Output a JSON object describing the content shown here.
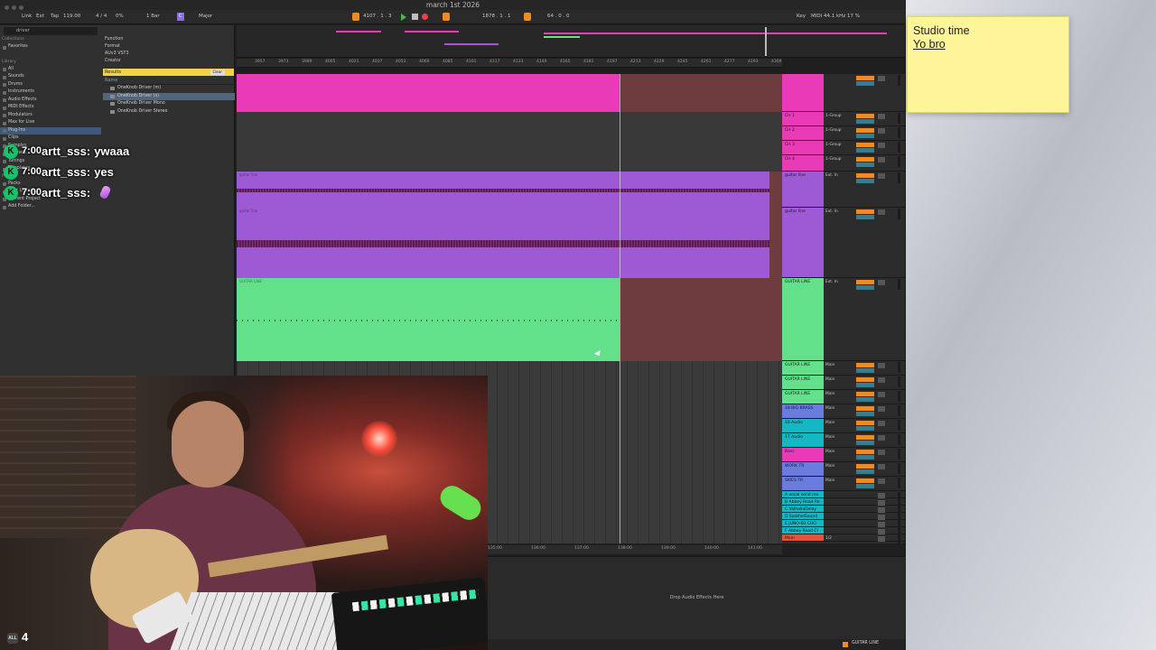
{
  "window": {
    "title": "march 1st 2026"
  },
  "transport": {
    "link": "Link",
    "ext": "Ext",
    "tap": "Tap",
    "tempo": "119.00",
    "signature": "4 / 4",
    "percent": "0%",
    "bar": "1 Bar",
    "key_root": "C",
    "scale": "Major",
    "position": "4107 . 1 . 3",
    "loop_start": "1878 . 1 . 1",
    "loop_len": "64 . 0 . 0",
    "key_label": "Key",
    "midi_label": "MIDI",
    "sample_rate": "44.1 kHz",
    "cpu": "17 %"
  },
  "browser": {
    "search_value": "driver",
    "collections_head": "Collections",
    "favorites": "Favorites",
    "library_head": "Library",
    "library": [
      "All",
      "Sounds",
      "Drums",
      "Instruments",
      "Audio Effects",
      "MIDI Effects",
      "Modulators",
      "Max for Live",
      "Plug-Ins",
      "Clips",
      "Samples",
      "Grooves",
      "Tunings",
      "Templates"
    ],
    "places_head": "Places",
    "places": [
      "Packs",
      "User Library",
      "Current Project",
      "Add Folder..."
    ],
    "filters": [
      "Function",
      "Format",
      "AUv3   VST3",
      "Creator"
    ],
    "results_label": "Results",
    "clear_label": "Clear",
    "name_head": "Name",
    "results": [
      "OneKnob Driver (m)",
      "OneKnob Driver (s)",
      "OneKnob Driver Mono",
      "OneKnob Driver Stereo"
    ]
  },
  "ruler_ticks": [
    "3957",
    "3973",
    "3989",
    "4005",
    "4021",
    "4037",
    "4053",
    "4069",
    "4085",
    "4101",
    "4117",
    "4133",
    "4149",
    "4165",
    "4181",
    "4197",
    "4213",
    "4229",
    "4245",
    "4261",
    "4277",
    "4293",
    "4309"
  ],
  "bottom_ticks": [
    "135:00",
    "136:00",
    "137:00",
    "138:00",
    "139:00",
    "140:00",
    "141:00"
  ],
  "tracks": [
    {
      "name": "",
      "io": "",
      "color": "#e93bb7"
    },
    {
      "name": "CH 1",
      "io": "1-Group",
      "color": "#e93bb7"
    },
    {
      "name": "CH 2",
      "io": "1-Group",
      "color": "#e93bb7"
    },
    {
      "name": "CH 3",
      "io": "1-Group",
      "color": "#e93bb7"
    },
    {
      "name": "CH 4",
      "io": "1-Group",
      "color": "#e93bb7"
    },
    {
      "name": "guitar line",
      "io": "Ext. In",
      "color": "#9e5ad4"
    },
    {
      "name": "guitar line",
      "io": "Ext. In",
      "color": "#9e5ad4"
    },
    {
      "name": "GUITAR LINE",
      "io": "Ext. In",
      "color": "#63e08a"
    },
    {
      "name": "GUITAR LINE",
      "io": "Main",
      "color": "#63e08a"
    },
    {
      "name": "GUITAR LINE",
      "io": "Main",
      "color": "#63e08a"
    },
    {
      "name": "GUITAR LINE",
      "io": "Main",
      "color": "#63e08a"
    },
    {
      "name": "18 BIG BRASS",
      "io": "Main",
      "color": "#6a7ce0"
    },
    {
      "name": "16 Audio",
      "io": "Main",
      "color": "#17b6c3"
    },
    {
      "name": "17 Audio",
      "io": "Main",
      "color": "#17b6c3"
    },
    {
      "name": "Bass",
      "io": "Main",
      "color": "#e93bb7"
    },
    {
      "name": "WORK TR",
      "io": "Main",
      "color": "#6a7ce0"
    },
    {
      "name": "SKIES TR",
      "io": "Main",
      "color": "#6a7ce0"
    },
    {
      "name": "A vocal send rev",
      "io": "",
      "color": "#17b6c3"
    },
    {
      "name": "B Abbey Road Re",
      "io": "",
      "color": "#17b6c3"
    },
    {
      "name": "C ValhallaDelay",
      "io": "",
      "color": "#17b6c3"
    },
    {
      "name": "D SoothelSound",
      "io": "",
      "color": "#17b6c3"
    },
    {
      "name": "E JUNO-60 CHO",
      "io": "",
      "color": "#17b6c3"
    },
    {
      "name": "F Abbey Road Cl",
      "io": "",
      "color": "#17b6c3"
    },
    {
      "name": "Main",
      "io": "1/2",
      "color": "#e0543a"
    }
  ],
  "clip_labels": {
    "guitar": "guitar line",
    "green": "GUITAR LINE"
  },
  "detail": {
    "drop_text": "Drop Audio Effects Here",
    "status_track": "GUITAR LINE"
  },
  "sticky": {
    "line1": "Studio time",
    "line2": "Yo bro"
  },
  "chat": [
    {
      "time": "7:00",
      "user": "artt_sss:",
      "text": "ywaaa"
    },
    {
      "time": "7:00",
      "user": "artt_sss:",
      "text": "yes"
    },
    {
      "time": "7:00",
      "user": "artt_sss:",
      "text": ""
    }
  ],
  "webcam": {
    "badge_all": "ALL",
    "viewers": "4"
  },
  "colors": {
    "pink": "#e93bb7",
    "purple": "#9e5ad4",
    "green": "#63e08a",
    "accent": "#f08a24"
  }
}
